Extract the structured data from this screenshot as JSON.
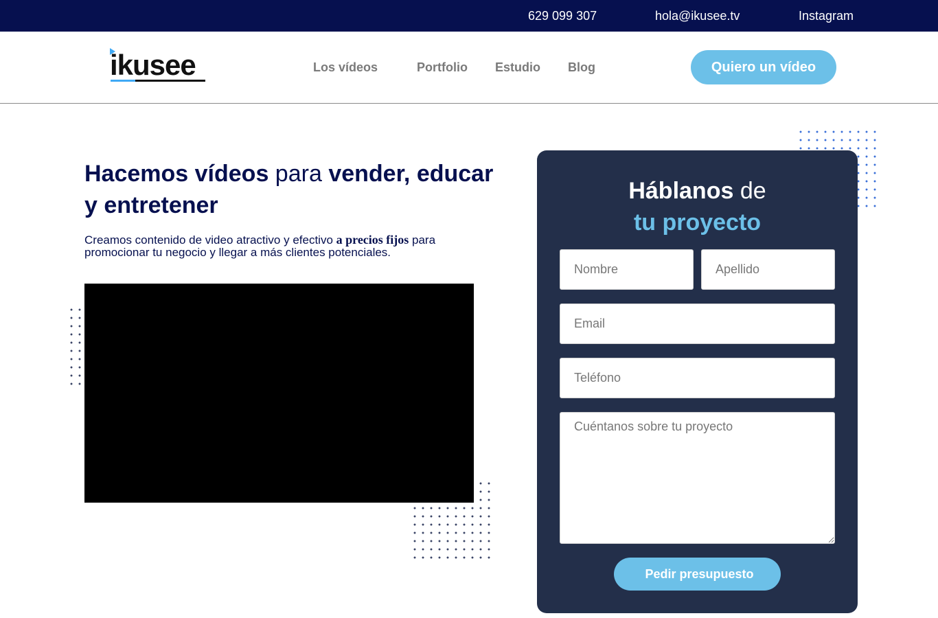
{
  "topbar": {
    "phone": {
      "icon": "phone-icon",
      "glyph": "",
      "text": "629 099 307"
    },
    "email": {
      "icon": "envelope-icon",
      "glyph": "",
      "text": "hola@ikusee.tv"
    },
    "instagram": {
      "icon": "instagram-icon",
      "glyph": "",
      "text": "Instagram"
    }
  },
  "header": {
    "logo_text": "ikusee",
    "nav": [
      {
        "label": "Los vídeos",
        "chevron": ""
      },
      {
        "label": "Portfolio"
      },
      {
        "label": "Estudio"
      },
      {
        "label": "Blog"
      }
    ],
    "cta_label": "Quiero un vídeo"
  },
  "hero": {
    "title_part1": "Hacemos vídeos",
    "title_part2": " para ",
    "title_part3": "vender, educar y entretener",
    "sub_part1": "Creamos contenido de video atractivo y efectivo ",
    "sub_emphasis": "a precios fijos",
    "sub_part2": " para promocionar tu negocio y llegar a más clientes potenciales."
  },
  "form": {
    "title_strong": "Háblanos",
    "title_light": " de",
    "title_accent": "tu proyecto",
    "nombre_placeholder": "Nombre",
    "apellido_placeholder": "Apellido",
    "email_placeholder": "Email",
    "telefono_placeholder": "Teléfono",
    "mensaje_placeholder": "Cuéntanos sobre tu proyecto",
    "submit_glyph": "",
    "submit_label": "Pedir presupuesto"
  },
  "colors": {
    "navy": "#06104f",
    "card": "#232f4a",
    "accent": "#6cc0e8",
    "dots_blue": "#3a6fd8",
    "dots_dark": "#3a4466"
  }
}
